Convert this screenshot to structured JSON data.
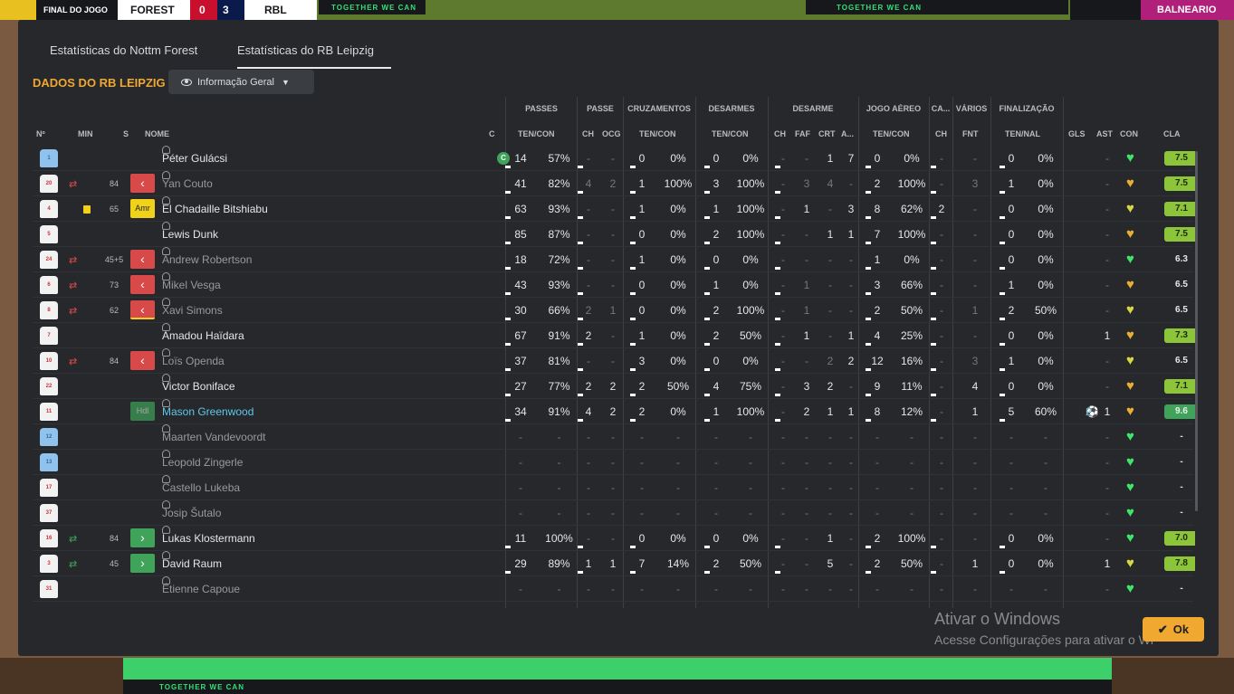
{
  "scoreboard": {
    "final_label": "FINAL DO JOGO",
    "home_team": "FOREST",
    "home_score": "0",
    "away_score": "3",
    "away_abbr": "RBL",
    "away_label": "BALNEARIO",
    "banner": "TOGETHER WE CAN"
  },
  "tabs": [
    "Estatísticas do Nottm Forest",
    "Estatísticas do RB Leipzig"
  ],
  "section_title": "DADOS DO RB LEIPZIG",
  "view_dropdown": "Informação Geral",
  "group_headers": {
    "passes": "PASSES",
    "passe": "PASSE",
    "cruzamentos": "CRUZAMENTOS",
    "desarmes": "DESARMES",
    "desarme": "DESARME",
    "jogo_aereo": "JOGO AÉREO",
    "ca": "CA...",
    "varios": "VÁRIOS",
    "finalizacao": "FINALIZAÇÃO"
  },
  "column_headers": {
    "n": "Nº",
    "min": "MIN",
    "s": "S",
    "nome": "NOME",
    "c": "C",
    "passes": "TEN/CON",
    "passe_ch": "CH",
    "passe_ocg": "OCG",
    "cruz": "TEN/CON",
    "desarmes": "TEN/CON",
    "des_ch": "CH",
    "des_faf": "FAF",
    "des_crt": "CRT",
    "des_a": "A...",
    "aereo": "TEN/CON",
    "ca_ch": "CH",
    "fnt": "FNT",
    "fin": "TEN/NAL",
    "gls": "GLS",
    "ast": "AST",
    "con": "CON",
    "cla": "CLA"
  },
  "players": [
    {
      "num": "1",
      "gk": true,
      "sub": "",
      "min": "",
      "status": "",
      "name": "Péter Gulácsi",
      "capt": "C",
      "card": false,
      "dim": false,
      "hl": false,
      "pa": "14",
      "pp": "57%",
      "ch": "-",
      "ocg": "-",
      "cra": "0",
      "crp": "0%",
      "dea": "0",
      "dep": "0%",
      "dch": "-",
      "faf": "-",
      "crt": "1",
      "da": "7",
      "aa": "0",
      "ap": "0%",
      "cach": "-",
      "fnt": "-",
      "fa": "0",
      "fp": "0%",
      "gls": "",
      "ast": "-",
      "con": "g",
      "cla": "7.5",
      "clat": "g"
    },
    {
      "num": "20",
      "gk": false,
      "sub": "out",
      "min": "84",
      "status": "out",
      "name": "Yan Couto",
      "capt": "",
      "card": false,
      "dim": true,
      "hl": false,
      "pa": "41",
      "pp": "82%",
      "ch": "4",
      "ocg": "2",
      "cra": "1",
      "crp": "100%",
      "dea": "3",
      "dep": "100%",
      "dch": "-",
      "faf": "3",
      "crt": "4",
      "da": "-",
      "aa": "2",
      "ap": "100%",
      "cach": "-",
      "fnt": "3",
      "fa": "1",
      "fp": "0%",
      "gls": "",
      "ast": "-",
      "con": "o",
      "cla": "7.5",
      "clat": "g"
    },
    {
      "num": "4",
      "gk": false,
      "sub": "",
      "min": "65",
      "status": "amr",
      "name": "El Chadaille Bitshiabu",
      "capt": "",
      "card": true,
      "dim": false,
      "hl": false,
      "pa": "63",
      "pp": "93%",
      "ch": "-",
      "ocg": "-",
      "cra": "1",
      "crp": "0%",
      "dea": "1",
      "dep": "100%",
      "dch": "-",
      "faf": "1",
      "crt": "-",
      "da": "3",
      "aa": "8",
      "ap": "62%",
      "cach": "2",
      "fnt": "-",
      "fa": "0",
      "fp": "0%",
      "gls": "",
      "ast": "-",
      "con": "y",
      "cla": "7.1",
      "clat": "g"
    },
    {
      "num": "5",
      "gk": false,
      "sub": "",
      "min": "",
      "status": "",
      "name": "Lewis Dunk",
      "capt": "",
      "card": false,
      "dim": false,
      "hl": false,
      "pa": "85",
      "pp": "87%",
      "ch": "-",
      "ocg": "-",
      "cra": "0",
      "crp": "0%",
      "dea": "2",
      "dep": "100%",
      "dch": "-",
      "faf": "-",
      "crt": "1",
      "da": "1",
      "aa": "7",
      "ap": "100%",
      "cach": "-",
      "fnt": "-",
      "fa": "0",
      "fp": "0%",
      "gls": "",
      "ast": "-",
      "con": "o",
      "cla": "7.5",
      "clat": "g"
    },
    {
      "num": "24",
      "gk": false,
      "sub": "out",
      "min": "45+5",
      "status": "out",
      "name": "Andrew Robertson",
      "capt": "",
      "card": false,
      "dim": true,
      "hl": false,
      "pa": "18",
      "pp": "72%",
      "ch": "-",
      "ocg": "-",
      "cra": "1",
      "crp": "0%",
      "dea": "0",
      "dep": "0%",
      "dch": "-",
      "faf": "-",
      "crt": "-",
      "da": "-",
      "aa": "1",
      "ap": "0%",
      "cach": "-",
      "fnt": "-",
      "fa": "0",
      "fp": "0%",
      "gls": "",
      "ast": "-",
      "con": "g",
      "cla": "6.3",
      "clat": "n"
    },
    {
      "num": "6",
      "gk": false,
      "sub": "out",
      "min": "73",
      "status": "out",
      "name": "Mikel Vesga",
      "capt": "",
      "card": false,
      "dim": true,
      "hl": false,
      "pa": "43",
      "pp": "93%",
      "ch": "-",
      "ocg": "-",
      "cra": "0",
      "crp": "0%",
      "dea": "1",
      "dep": "0%",
      "dch": "-",
      "faf": "1",
      "crt": "-",
      "da": "-",
      "aa": "3",
      "ap": "66%",
      "cach": "-",
      "fnt": "-",
      "fa": "1",
      "fp": "0%",
      "gls": "",
      "ast": "-",
      "con": "o",
      "cla": "6.5",
      "clat": "n"
    },
    {
      "num": "8",
      "gk": false,
      "sub": "out",
      "min": "62",
      "status": "outy",
      "name": "Xavi Simons",
      "capt": "",
      "card": false,
      "dim": true,
      "hl": false,
      "pa": "30",
      "pp": "66%",
      "ch": "2",
      "ocg": "1",
      "cra": "0",
      "crp": "0%",
      "dea": "2",
      "dep": "100%",
      "dch": "-",
      "faf": "1",
      "crt": "-",
      "da": "-",
      "aa": "2",
      "ap": "50%",
      "cach": "-",
      "fnt": "1",
      "fa": "2",
      "fp": "50%",
      "gls": "",
      "ast": "-",
      "con": "y",
      "cla": "6.5",
      "clat": "n"
    },
    {
      "num": "7",
      "gk": false,
      "sub": "",
      "min": "",
      "status": "",
      "name": "Amadou Haïdara",
      "capt": "",
      "card": false,
      "dim": false,
      "hl": false,
      "pa": "67",
      "pp": "91%",
      "ch": "2",
      "ocg": "-",
      "cra": "1",
      "crp": "0%",
      "dea": "2",
      "dep": "50%",
      "dch": "-",
      "faf": "1",
      "crt": "-",
      "da": "1",
      "aa": "4",
      "ap": "25%",
      "cach": "-",
      "fnt": "-",
      "fa": "0",
      "fp": "0%",
      "gls": "",
      "ast": "1",
      "con": "o",
      "cla": "7.3",
      "clat": "g"
    },
    {
      "num": "10",
      "gk": false,
      "sub": "out",
      "min": "84",
      "status": "out",
      "name": "Loïs Openda",
      "capt": "",
      "card": false,
      "dim": true,
      "hl": false,
      "pa": "37",
      "pp": "81%",
      "ch": "-",
      "ocg": "-",
      "cra": "3",
      "crp": "0%",
      "dea": "0",
      "dep": "0%",
      "dch": "-",
      "faf": "-",
      "crt": "2",
      "da": "2",
      "aa": "12",
      "ap": "16%",
      "cach": "-",
      "fnt": "3",
      "fa": "1",
      "fp": "0%",
      "gls": "",
      "ast": "-",
      "con": "y",
      "cla": "6.5",
      "clat": "n"
    },
    {
      "num": "22",
      "gk": false,
      "sub": "",
      "min": "",
      "status": "",
      "name": "Victor Boniface",
      "capt": "",
      "card": false,
      "dim": false,
      "hl": false,
      "pa": "27",
      "pp": "77%",
      "ch": "2",
      "ocg": "2",
      "cra": "2",
      "crp": "50%",
      "dea": "4",
      "dep": "75%",
      "dch": "-",
      "faf": "3",
      "crt": "2",
      "da": "-",
      "aa": "9",
      "ap": "11%",
      "cach": "-",
      "fnt": "4",
      "fa": "0",
      "fp": "0%",
      "gls": "",
      "ast": "-",
      "con": "o",
      "cla": "7.1",
      "clat": "g"
    },
    {
      "num": "11",
      "gk": false,
      "sub": "",
      "min": "",
      "status": "hd",
      "name": "Mason Greenwood",
      "capt": "",
      "card": false,
      "dim": false,
      "hl": true,
      "pa": "34",
      "pp": "91%",
      "ch": "4",
      "ocg": "2",
      "cra": "2",
      "crp": "0%",
      "dea": "1",
      "dep": "100%",
      "dch": "-",
      "faf": "2",
      "crt": "1",
      "da": "1",
      "aa": "8",
      "ap": "12%",
      "cach": "-",
      "fnt": "1",
      "fa": "5",
      "fp": "60%",
      "gls": "2",
      "ast": "1",
      "con": "o",
      "cla": "9.6",
      "clat": "dg"
    },
    {
      "num": "12",
      "gk": true,
      "sub": "",
      "min": "",
      "status": "",
      "name": "Maarten Vandevoordt",
      "capt": "",
      "card": false,
      "dim": true,
      "hl": false,
      "pa": "-",
      "pp": "-",
      "ch": "-",
      "ocg": "-",
      "cra": "-",
      "crp": "-",
      "dea": "-",
      "dep": "-",
      "dch": "-",
      "faf": "-",
      "crt": "-",
      "da": "-",
      "aa": "-",
      "ap": "-",
      "cach": "-",
      "fnt": "-",
      "fa": "-",
      "fp": "-",
      "gls": "",
      "ast": "-",
      "con": "g",
      "cla": "-",
      "clat": "n"
    },
    {
      "num": "13",
      "gk": true,
      "sub": "",
      "min": "",
      "status": "",
      "name": "Leopold Zingerle",
      "capt": "",
      "card": false,
      "dim": true,
      "hl": false,
      "pa": "-",
      "pp": "-",
      "ch": "-",
      "ocg": "-",
      "cra": "-",
      "crp": "-",
      "dea": "-",
      "dep": "-",
      "dch": "-",
      "faf": "-",
      "crt": "-",
      "da": "-",
      "aa": "-",
      "ap": "-",
      "cach": "-",
      "fnt": "-",
      "fa": "-",
      "fp": "-",
      "gls": "",
      "ast": "-",
      "con": "g",
      "cla": "-",
      "clat": "n"
    },
    {
      "num": "17",
      "gk": false,
      "sub": "",
      "min": "",
      "status": "",
      "name": "Castello Lukeba",
      "capt": "",
      "card": false,
      "dim": true,
      "hl": false,
      "pa": "-",
      "pp": "-",
      "ch": "-",
      "ocg": "-",
      "cra": "-",
      "crp": "-",
      "dea": "-",
      "dep": "-",
      "dch": "-",
      "faf": "-",
      "crt": "-",
      "da": "-",
      "aa": "-",
      "ap": "-",
      "cach": "-",
      "fnt": "-",
      "fa": "-",
      "fp": "-",
      "gls": "",
      "ast": "-",
      "con": "g",
      "cla": "-",
      "clat": "n"
    },
    {
      "num": "37",
      "gk": false,
      "sub": "",
      "min": "",
      "status": "",
      "name": "Josip Šutalo",
      "capt": "",
      "card": false,
      "dim": true,
      "hl": false,
      "pa": "-",
      "pp": "-",
      "ch": "-",
      "ocg": "-",
      "cra": "-",
      "crp": "-",
      "dea": "-",
      "dep": "-",
      "dch": "-",
      "faf": "-",
      "crt": "-",
      "da": "-",
      "aa": "-",
      "ap": "-",
      "cach": "-",
      "fnt": "-",
      "fa": "-",
      "fp": "-",
      "gls": "",
      "ast": "-",
      "con": "g",
      "cla": "-",
      "clat": "n"
    },
    {
      "num": "16",
      "gk": false,
      "sub": "in",
      "min": "84",
      "status": "in",
      "name": "Lukas Klostermann",
      "capt": "",
      "card": false,
      "dim": false,
      "hl": false,
      "pa": "11",
      "pp": "100%",
      "ch": "-",
      "ocg": "-",
      "cra": "0",
      "crp": "0%",
      "dea": "0",
      "dep": "0%",
      "dch": "-",
      "faf": "-",
      "crt": "1",
      "da": "-",
      "aa": "2",
      "ap": "100%",
      "cach": "-",
      "fnt": "-",
      "fa": "0",
      "fp": "0%",
      "gls": "",
      "ast": "-",
      "con": "g",
      "cla": "7.0",
      "clat": "g"
    },
    {
      "num": "3",
      "gk": false,
      "sub": "in",
      "min": "45",
      "status": "in",
      "name": "David Raum",
      "capt": "",
      "card": false,
      "dim": false,
      "hl": false,
      "pa": "29",
      "pp": "89%",
      "ch": "1",
      "ocg": "1",
      "cra": "7",
      "crp": "14%",
      "dea": "2",
      "dep": "50%",
      "dch": "-",
      "faf": "-",
      "crt": "5",
      "da": "-",
      "aa": "2",
      "ap": "50%",
      "cach": "-",
      "fnt": "1",
      "fa": "0",
      "fp": "0%",
      "gls": "",
      "ast": "1",
      "con": "y",
      "cla": "7.8",
      "clat": "g"
    },
    {
      "num": "31",
      "gk": false,
      "sub": "",
      "min": "",
      "status": "",
      "name": "Étienne Capoue",
      "capt": "",
      "card": false,
      "dim": true,
      "hl": false,
      "pa": "-",
      "pp": "-",
      "ch": "-",
      "ocg": "-",
      "cra": "-",
      "crp": "-",
      "dea": "-",
      "dep": "-",
      "dch": "-",
      "faf": "-",
      "crt": "-",
      "da": "-",
      "aa": "-",
      "ap": "-",
      "cach": "-",
      "fnt": "-",
      "fa": "-",
      "fp": "-",
      "gls": "",
      "ast": "-",
      "con": "g",
      "cla": "-",
      "clat": "n"
    }
  ],
  "ok_button": "Ok",
  "watermark": {
    "line1": "Ativar o Windows",
    "line2": "Acesse Configurações para ativar o Wi"
  }
}
